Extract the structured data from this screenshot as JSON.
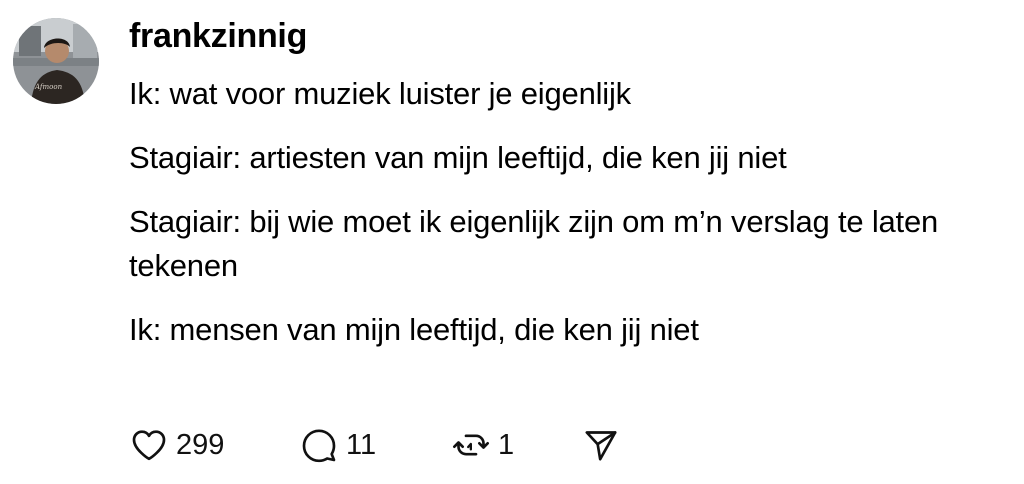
{
  "post": {
    "username": "frankzinnig",
    "avatar_icon": "profile-photo",
    "paragraphs": [
      "Ik: wat voor muziek luister je eigenlijk",
      "Stagiair: artiesten van mijn leeftijd, die ken jij niet",
      "Stagiair: bij wie moet ik eigenlijk zijn om m’n verslag te laten tekenen",
      "Ik: mensen van mijn leeftijd, die ken jij niet"
    ],
    "actions": {
      "likes": "299",
      "replies": "11",
      "reposts": "1"
    },
    "icons": {
      "like": "heart-icon",
      "reply": "comment-bubble-icon",
      "repost": "repost-icon",
      "share": "send-icon"
    }
  }
}
